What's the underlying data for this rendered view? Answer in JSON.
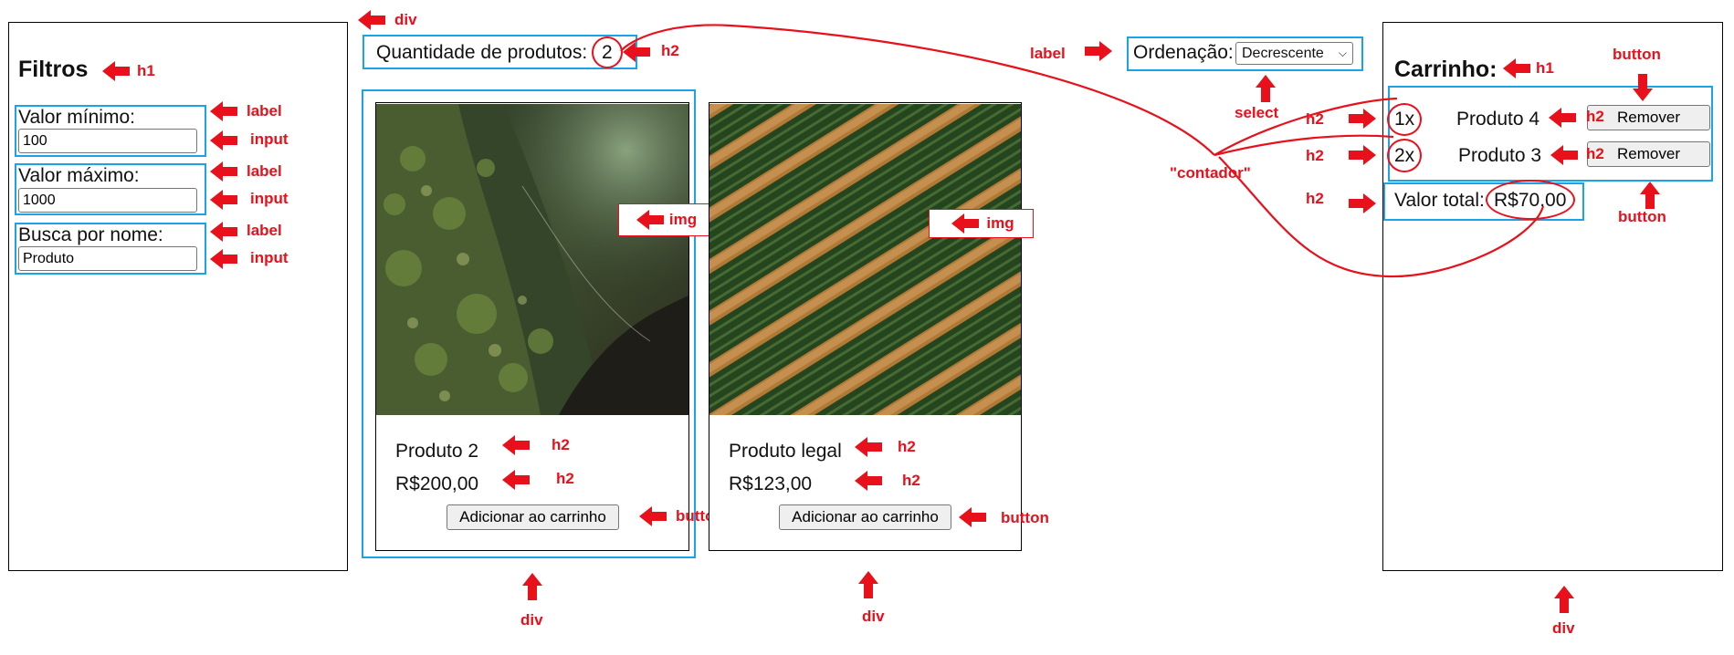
{
  "filters": {
    "title": "Filtros",
    "min_label": "Valor mínimo:",
    "min_value": "100",
    "max_label": "Valor máximo:",
    "max_value": "1000",
    "name_label": "Busca por nome:",
    "name_value": "Produto"
  },
  "products_header": {
    "count_label": "Quantidade de produtos:",
    "count_value": "2",
    "sort_label": "Ordenação:",
    "sort_selected": "Decrescente"
  },
  "products": [
    {
      "name": "Produto 2",
      "price": "R$200,00",
      "button": "Adicionar ao carrinho",
      "image": "moss-tree-photo"
    },
    {
      "name": "Produto legal",
      "price": "R$123,00",
      "button": "Adicionar ao carrinho",
      "image": "crop-field-aerial-photo"
    }
  ],
  "cart": {
    "title": "Carrinho:",
    "items": [
      {
        "qty": "1x",
        "name": "Produto 4",
        "button": "Remover"
      },
      {
        "qty": "2x",
        "name": "Produto 3",
        "button": "Remover"
      }
    ],
    "total_label": "Valor total:",
    "total_value": "R$70,00"
  },
  "annotations": {
    "div": "div",
    "h1": "h1",
    "h2": "h2",
    "label": "label",
    "input": "input",
    "img": "img",
    "button": "button",
    "select": "select",
    "contador": "\"contador\""
  },
  "colors": {
    "annotation_red": "#e8101a",
    "highlight_blue": "#1aa3e8"
  }
}
